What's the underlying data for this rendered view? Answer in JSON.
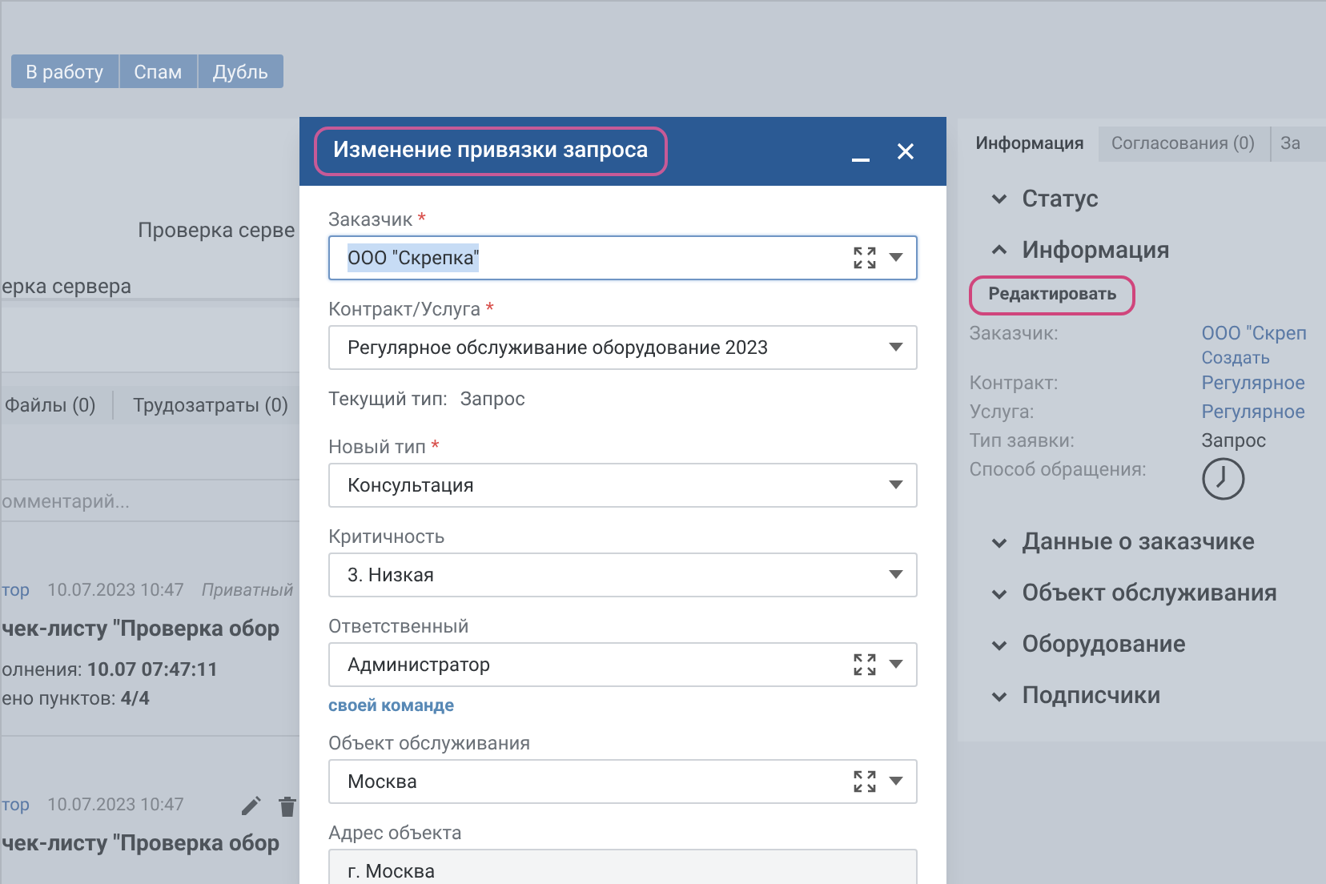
{
  "toolbar": {
    "buttons": [
      "В работу",
      "Спам",
      "Дубль"
    ]
  },
  "request": {
    "lines": [
      "Проверка серве",
      "ерка сервера"
    ]
  },
  "tabs": [
    {
      "label": "Файлы (0)",
      "selected": false
    },
    {
      "label": "Трудозатраты (0)",
      "selected": false
    }
  ],
  "comment_field": {
    "placeholder": "омментарий..."
  },
  "comments": [
    {
      "author": "тор",
      "time": "10.07.2023 10:47",
      "private_label": "Приватный",
      "editable": false,
      "title": "чек-листу \"Проверка обор",
      "lines": [
        "олнения: **10.07 07:47:11**",
        "ено пунктов: **4/4**"
      ]
    },
    {
      "author": "тор",
      "time": "10.07.2023 10:47",
      "editable": true,
      "title": "чек-листу \"Проверка обор"
    }
  ],
  "side_panel": {
    "tabs": [
      {
        "label": "Информация",
        "selected": true
      },
      {
        "label": "Согласования (0)",
        "selected": false
      },
      {
        "label": "За",
        "selected": false
      }
    ],
    "sections": [
      {
        "title": "Статус",
        "expanded": false
      },
      {
        "title": "Информация",
        "expanded": true,
        "edit_link": "Редактировать",
        "edit_highlighted": true,
        "fields": [
          {
            "label": "Заказчик:",
            "kind": "link",
            "value": "ООО \"Скреп",
            "extra_link": "Создать"
          },
          {
            "label": "Контракт:",
            "kind": "link",
            "value": "Регулярное"
          },
          {
            "label": "Услуга:",
            "kind": "link",
            "value": "Регулярное"
          },
          {
            "label": "Тип заявки:",
            "kind": "text",
            "value": "Запрос"
          },
          {
            "label": "Способ обращения:",
            "kind": "clock"
          }
        ]
      },
      {
        "title": "Данные о заказчике",
        "expanded": false
      },
      {
        "title": "Объект обслуживания",
        "expanded": false
      },
      {
        "title": "Оборудование",
        "expanded": false
      },
      {
        "title": "Подписчики",
        "expanded": false
      }
    ]
  },
  "dialog": {
    "title": "Изменение привязки запроса",
    "title_highlighted": true,
    "fields": [
      {
        "kind": "select",
        "label": "Заказчик",
        "required_mark": "*",
        "value": "ООО \"Скрепка\"",
        "expandable": true,
        "focused": true,
        "text_selected": true
      },
      {
        "kind": "select",
        "label": "Контракт/Услуга",
        "required_mark": "*",
        "value": "Регулярное обслуживание оборудование 2023",
        "expandable": false,
        "focused": false,
        "text_selected": false
      },
      {
        "kind": "info",
        "label": "Текущий тип:",
        "value": "Запрос"
      },
      {
        "kind": "select",
        "label": "Новый тип",
        "required_mark": "*",
        "value": "Консультация",
        "expandable": false,
        "focused": false,
        "text_selected": false
      },
      {
        "kind": "select",
        "label": "Критичность",
        "value": "3. Низкая",
        "expandable": false,
        "focused": false,
        "text_selected": false
      },
      {
        "kind": "select",
        "label": "Ответственный",
        "value": "Администратор",
        "expandable": true,
        "focused": false,
        "text_selected": false,
        "link": "своей команде"
      },
      {
        "kind": "select",
        "label": "Объект обслуживания",
        "value": "Москва",
        "expandable": true,
        "focused": false,
        "text_selected": false
      },
      {
        "kind": "input",
        "label": "Адрес объекта",
        "value": "г. Москва"
      }
    ]
  }
}
